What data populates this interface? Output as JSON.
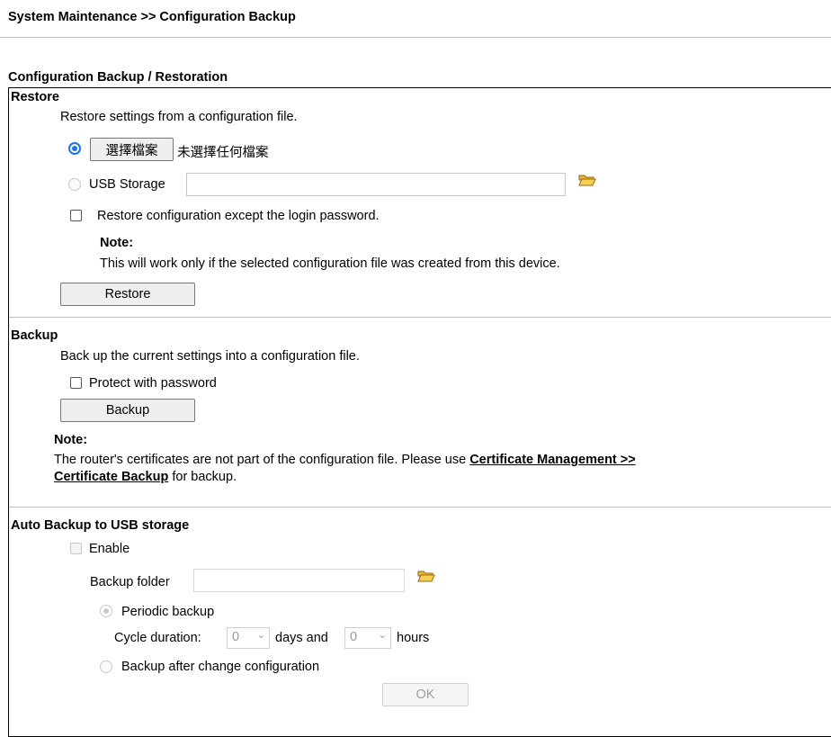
{
  "breadcrumb": "System Maintenance >> Configuration Backup",
  "section_title": "Configuration Backup / Restoration",
  "restore": {
    "heading": "Restore",
    "description": "Restore settings from a configuration file.",
    "file_button": "選擇檔案",
    "file_status": "未選擇任何檔案",
    "usb_label": "USB Storage",
    "usb_value": "",
    "except_password_label": "Restore configuration except the login password.",
    "note_label": "Note:",
    "note_text": "This will work only if the selected configuration file was created from this device.",
    "button": "Restore"
  },
  "backup": {
    "heading": "Backup",
    "description": "Back up the current settings into a configuration file.",
    "protect_label": "Protect with password",
    "button": "Backup",
    "note_label": "Note:",
    "note_text_1": "The router's certificates are not part of the configuration file. Please use ",
    "note_link_1": "Certificate Management >>",
    "note_link_2": "Certificate Backup",
    "note_text_2": " for backup."
  },
  "auto_backup": {
    "heading": "Auto Backup to USB storage",
    "enable_label": "Enable",
    "folder_label": "Backup folder",
    "folder_value": "",
    "periodic_label": "Periodic backup",
    "cycle_label": "Cycle duration:",
    "days_value": "0",
    "days_label": "days and",
    "hours_value": "0",
    "hours_label": "hours",
    "after_change_label": "Backup after change configuration",
    "ok_button": "OK"
  },
  "icons": {
    "folder": "folder-open-icon",
    "dropdown": "chevron-down-icon"
  }
}
